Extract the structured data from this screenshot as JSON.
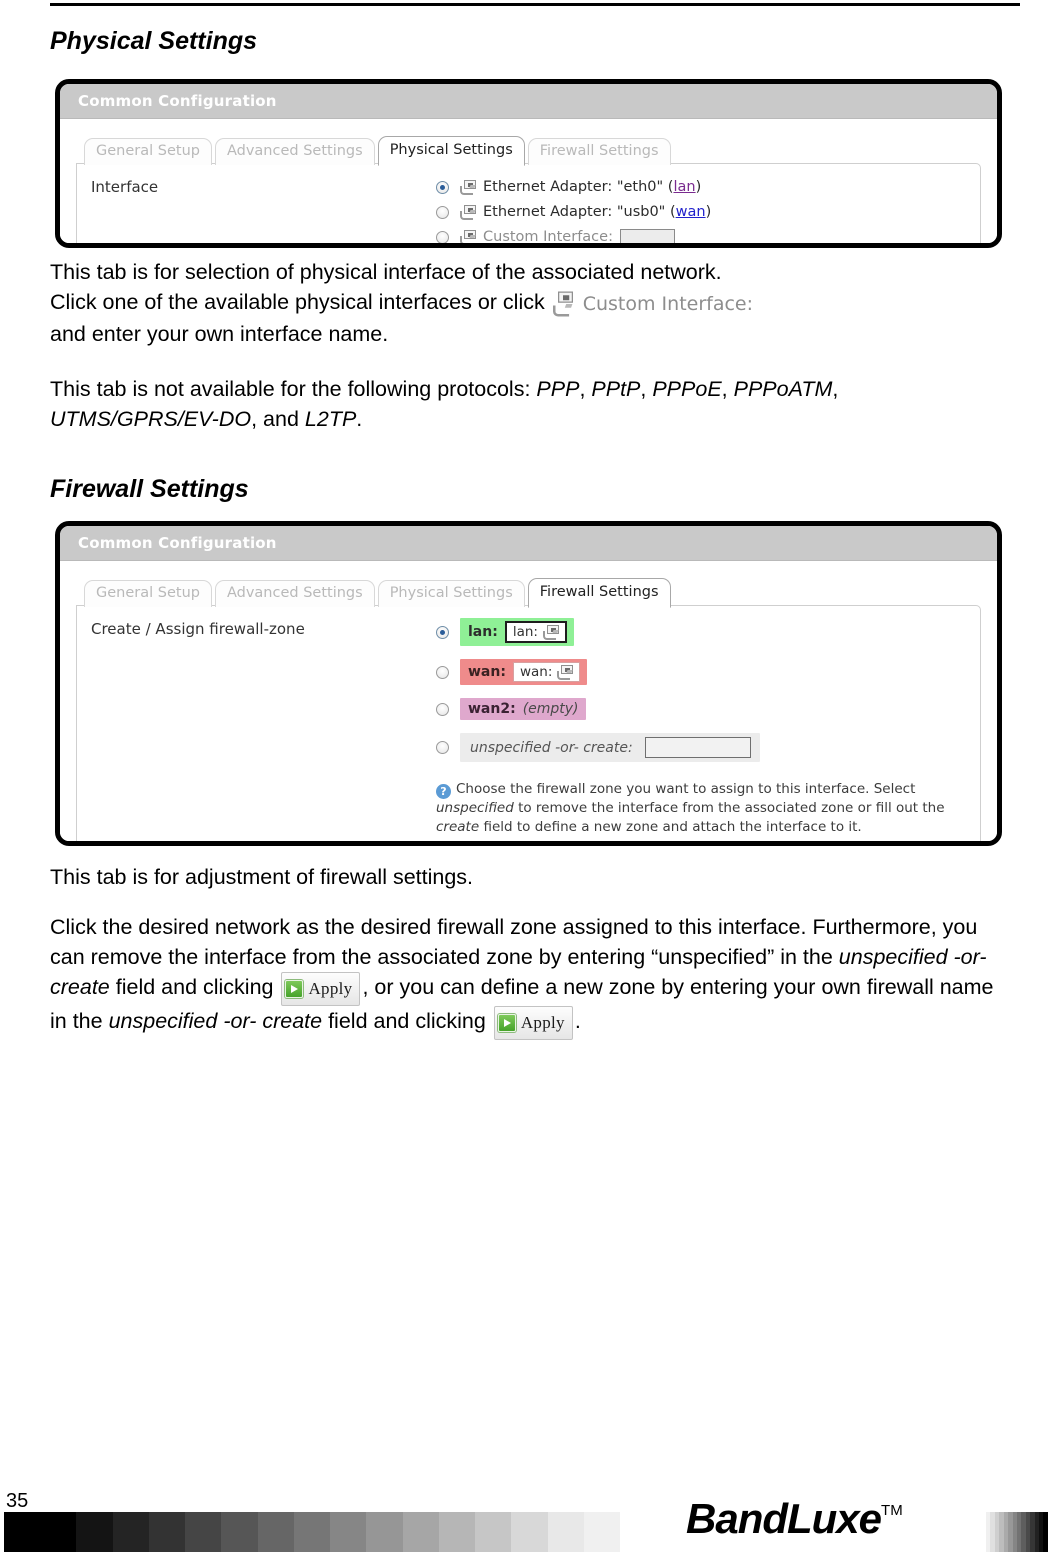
{
  "page": {
    "number": "35",
    "brand": "BandLuxe",
    "brand_tm": "TM"
  },
  "sections": [
    {
      "heading": "Physical Settings",
      "panel": {
        "header": "Common Configuration",
        "tabs": [
          {
            "label": "General Setup",
            "active": false
          },
          {
            "label": "Advanced Settings",
            "active": false
          },
          {
            "label": "Physical Settings",
            "active": true
          },
          {
            "label": "Firewall Settings",
            "active": false
          }
        ],
        "field_label": "Interface",
        "options": [
          {
            "prefix": "Ethernet Adapter: \"eth0\" (",
            "link": "lan",
            "suffix": ")",
            "selected": true
          },
          {
            "prefix": "Ethernet Adapter: \"usb0\" (",
            "link": "wan",
            "suffix": ")",
            "selected": false
          },
          {
            "prefix": "Custom Interface:",
            "link": "",
            "suffix": "",
            "selected": false,
            "textbox": true
          }
        ]
      }
    },
    {
      "heading": "Firewall Settings",
      "panel": {
        "header": "Common Configuration",
        "tabs": [
          {
            "label": "General Setup",
            "active": false
          },
          {
            "label": "Advanced Settings",
            "active": false
          },
          {
            "label": "Physical Settings",
            "active": false
          },
          {
            "label": "Firewall Settings",
            "active": true
          }
        ],
        "field_label": "Create / Assign firewall-zone",
        "zones": [
          {
            "name": "lan:",
            "chip": "lan:",
            "selected": true,
            "style": "lan"
          },
          {
            "name": "wan:",
            "chip": "wan:",
            "selected": false,
            "style": "wan"
          },
          {
            "name": "wan2:",
            "chip": "(empty)",
            "selected": false,
            "style": "wan2"
          },
          {
            "name": "unspecified -or- create:",
            "chip": "",
            "selected": false,
            "style": "unspec"
          }
        ],
        "help": {
          "icon": "question-mark-icon",
          "part1": "Choose the firewall zone you want to assign to this interface. Select ",
          "em1": "unspecified",
          "part2": " to remove the interface from the associated zone or fill out the ",
          "em2": "create",
          "part3": " field to define a new zone and attach the interface to it."
        }
      }
    }
  ],
  "paragraphs": {
    "physical_1a": "This tab is for selection of physical interface of the associated network.",
    "physical_1b": "Click one of the available physical interfaces or click",
    "physical_1c": "and enter your own interface name.",
    "custom_iface_caption": "Custom Interface:",
    "physical_2a": "This tab is not available for the following protocols: ",
    "protocols": [
      "PPP",
      "PPtP",
      "PPPoE",
      "PPPoATM",
      "UTMS/GPRS/EV-DO",
      "L2TP"
    ],
    "physical_2_and": "and",
    "firewall_1": "This tab is for adjustment of firewall settings.",
    "firewall_2a": "Click the desired network as the desired firewall zone assigned to this interface. Furthermore, you can remove the interface from the associated zone by entering “unspecified” in the ",
    "firewall_2_em1": "unspecified -or- create",
    "firewall_2b": " field and clicking",
    "firewall_2c": ", or you can define a new zone by entering your own firewall name in the ",
    "firewall_2_em2": "unspecified -or- create",
    "firewall_2d": " field and clicking",
    "firewall_2e": ".",
    "apply_label": "Apply"
  },
  "colors": {
    "zone_lan": "#8ff096",
    "zone_wan": "#ef8b8b",
    "zone_wan2": "#dfa8cd",
    "panel_header": "#c9c9c9",
    "link_lan": "#7a2b8f",
    "link_wan": "#2222cc",
    "help_icon": "#5b9bd5",
    "apply_green": "#46a32a"
  }
}
